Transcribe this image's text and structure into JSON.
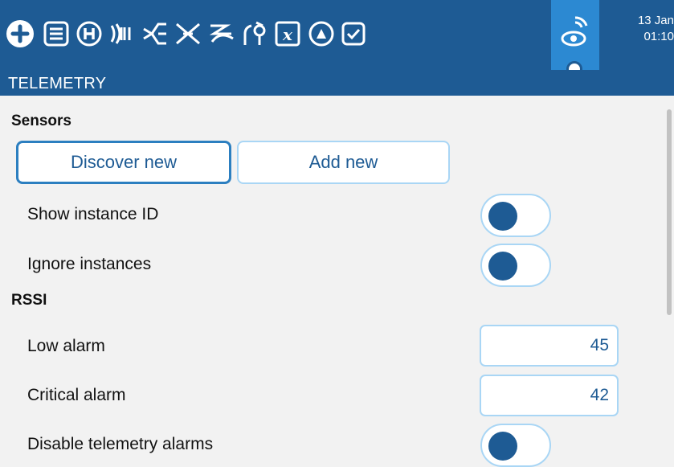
{
  "toolbar": {
    "icons": [
      "add-circle-icon",
      "menu-list-icon",
      "h-circle-icon",
      "signal-waves-icon",
      "mixer-icon",
      "crossed-arrows-icon",
      "curves-icon",
      "servo-icon",
      "variable-x-icon",
      "cloud-timer-icon",
      "checkbox-icon",
      "telemetry-eye-icon"
    ],
    "active_icon": "telemetry-eye-icon",
    "date": "13 Jan",
    "time": "01:10"
  },
  "page": {
    "title": "TELEMETRY"
  },
  "sensors": {
    "header": "Sensors",
    "discover_label": "Discover new",
    "add_label": "Add new",
    "show_instance_id": {
      "label": "Show instance ID",
      "value": false
    },
    "ignore_instances": {
      "label": "Ignore instances",
      "value": false
    }
  },
  "rssi": {
    "header": "RSSI",
    "low_alarm": {
      "label": "Low alarm",
      "value": "45"
    },
    "critical_alarm": {
      "label": "Critical alarm",
      "value": "42"
    },
    "disable_alarms": {
      "label": "Disable telemetry alarms",
      "value": false
    }
  },
  "colors": {
    "bar": "#1e5b94",
    "active_tab": "#2c89d2",
    "field_border": "#a9d6f5",
    "background": "#f2f2f2"
  }
}
